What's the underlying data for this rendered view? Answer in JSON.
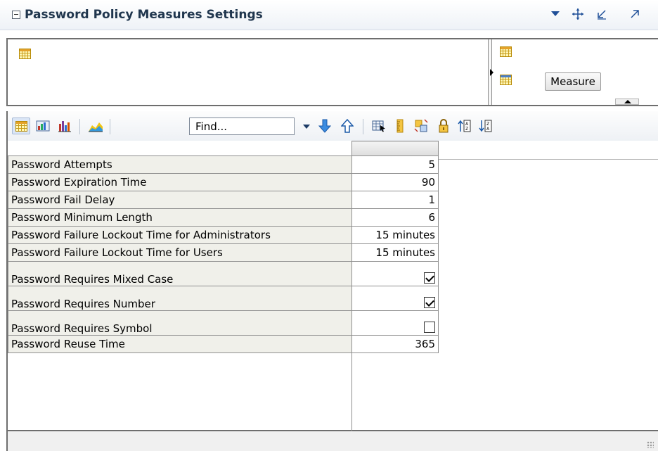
{
  "panel": {
    "title": "Password Policy Measures Settings"
  },
  "zones": {
    "measure_label": "Measure"
  },
  "toolbar": {
    "find_placeholder": "Find..."
  },
  "table": {
    "rows": [
      {
        "label": "Password Attempts",
        "value": "5"
      },
      {
        "label": "Password Expiration Time",
        "value": "90"
      },
      {
        "label": "Password Fail Delay",
        "value": "1"
      },
      {
        "label": "Password Minimum Length",
        "value": "6"
      },
      {
        "label": "Password Failure Lockout Time for Administrators",
        "value": "15 minutes"
      },
      {
        "label": "Password Failure Lockout Time for Users",
        "value": "15 minutes"
      },
      {
        "label": "Password Requires Mixed Case",
        "checked": true
      },
      {
        "label": "Password Requires Number",
        "checked": true
      },
      {
        "label": "Password Requires Symbol",
        "checked": false
      },
      {
        "label": "Password Reuse Time",
        "value": "365"
      }
    ]
  },
  "colors": {
    "title": "#20364e",
    "icon_blue": "#2d6fd1",
    "grid_icon_yellow": "#fff8b8"
  }
}
